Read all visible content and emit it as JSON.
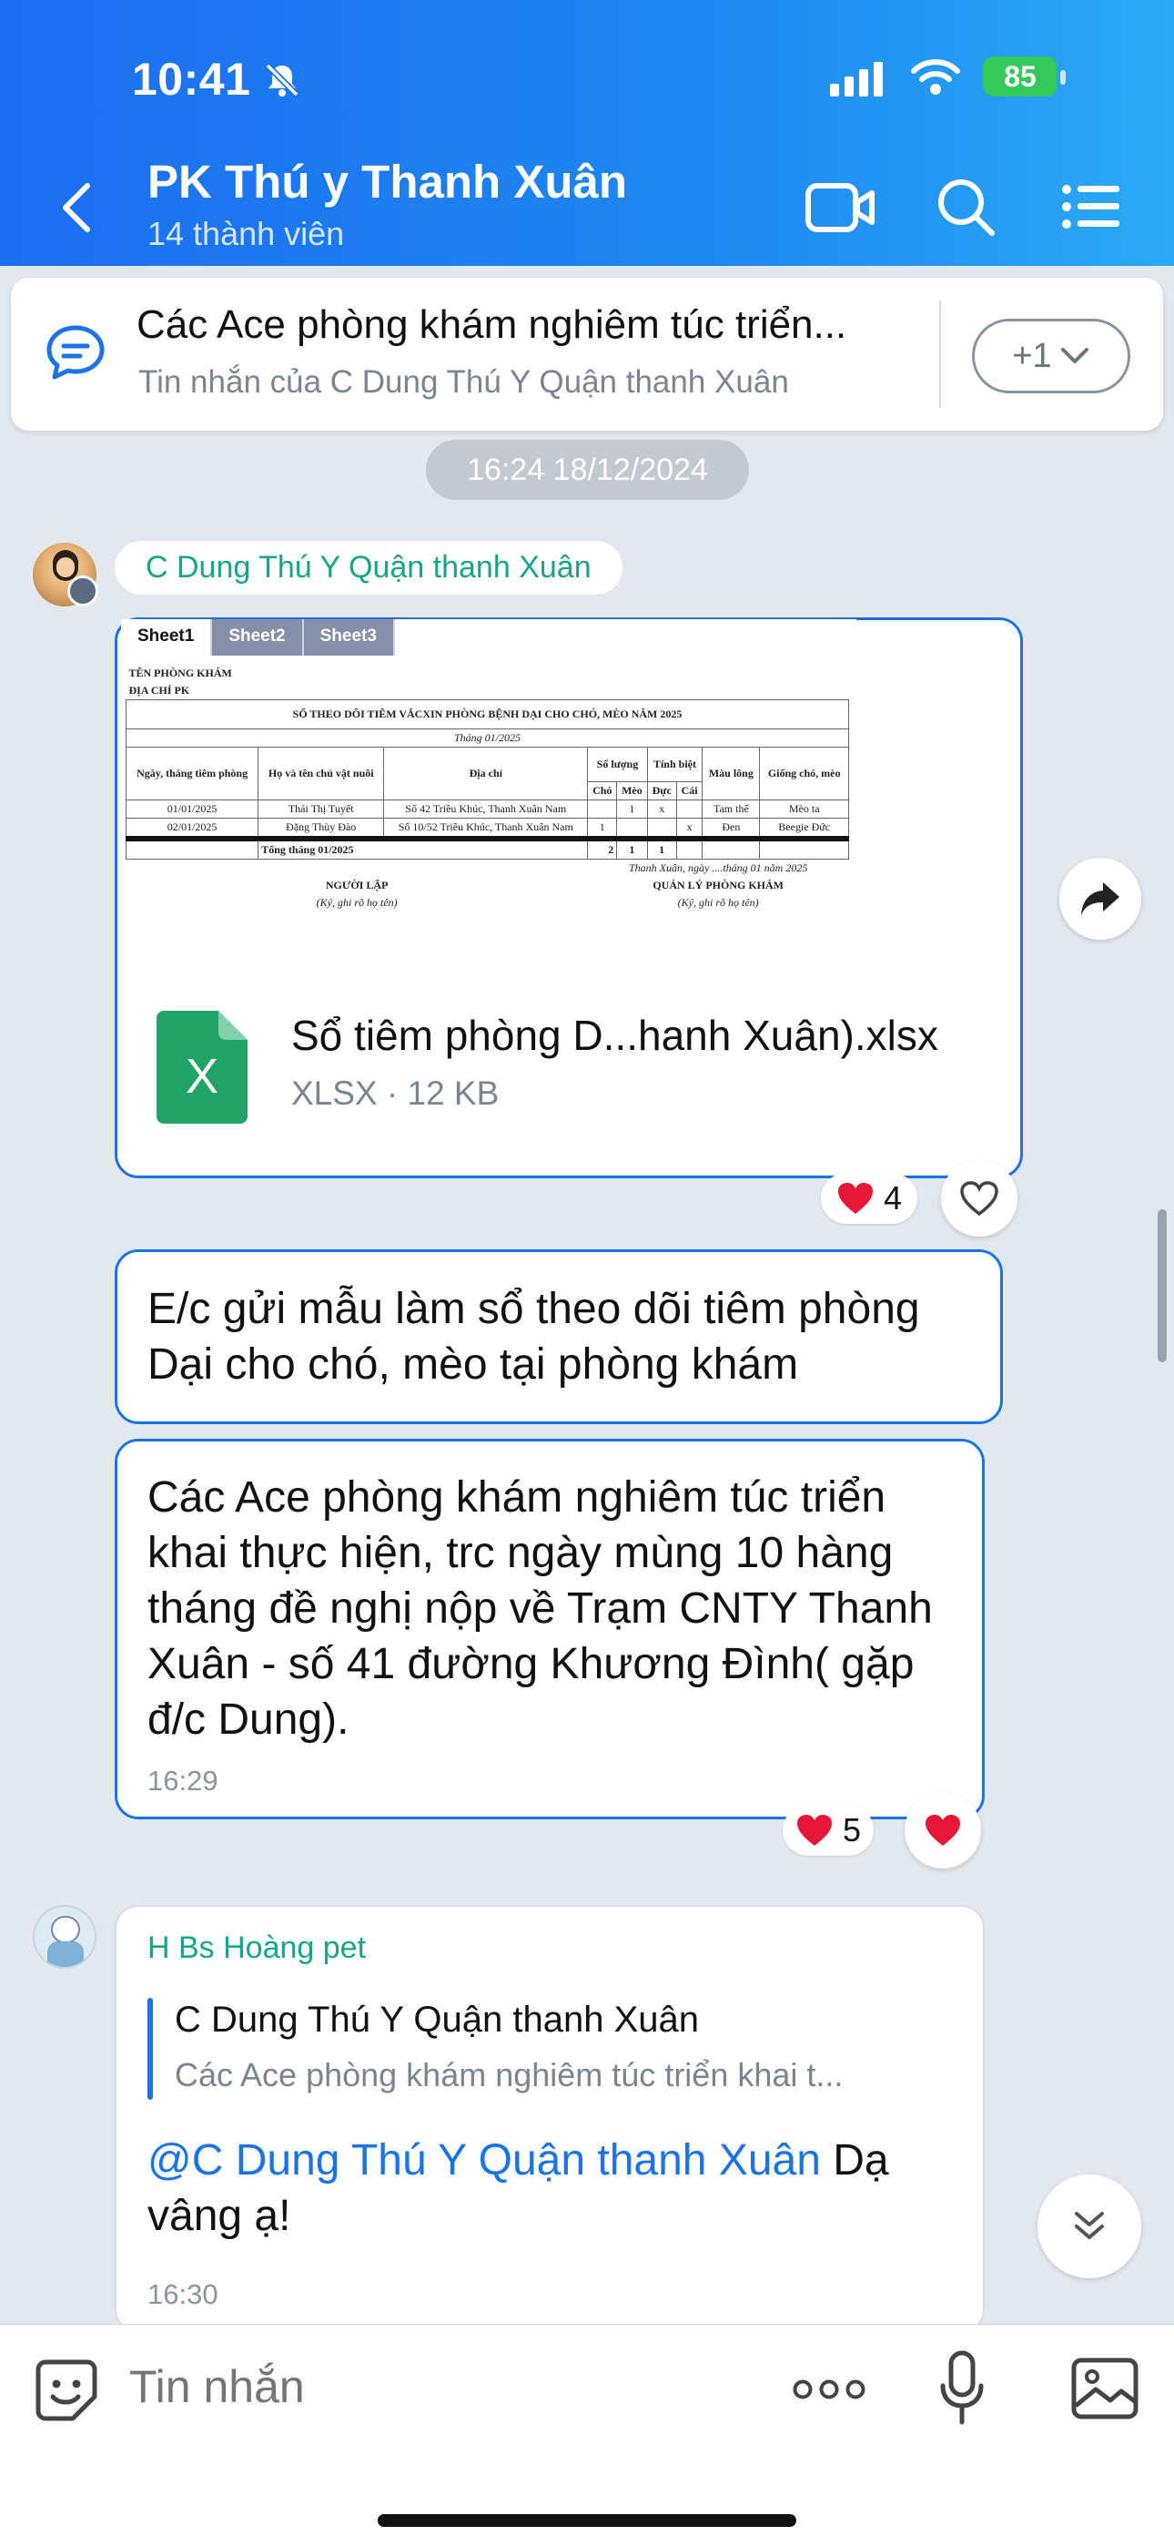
{
  "status_bar": {
    "time": "10:41",
    "battery": "85"
  },
  "header": {
    "title": "PK Thú y Thanh Xuân",
    "subtitle": "14 thành viên"
  },
  "pinned": {
    "text": "Các Ace phòng khám nghiêm túc triển...",
    "sub": "Tin nhắn của C Dung Thú Y Quận thanh Xuân",
    "more_label": "+1"
  },
  "date_separator": "16:24 18/12/2024",
  "message1": {
    "sender": "C Dung Thú Y Quận thanh Xuân",
    "sheet_tabs": [
      "Sheet1",
      "Sheet2",
      "Sheet3"
    ],
    "sheet": {
      "clinic_name": "TÊN PHÒNG KHÁM",
      "clinic_address": "ĐỊA CHỈ PK",
      "title": "SỔ THEO DÕI TIÊM VẮCXIN PHÒNG BỆNH DẠI CHO CHÓ, MÈO NĂM 2025",
      "month": "Tháng 01/2025",
      "headers": [
        "Ngày, tháng tiêm phòng",
        "Họ và tên chủ vật nuôi",
        "Địa chỉ",
        "Số lượng",
        "Tính biệt",
        "Màu lông",
        "Giống chó, mèo"
      ],
      "subheaders": [
        "Chó",
        "Mèo",
        "Đực",
        "Cái"
      ],
      "rows": [
        [
          "01/01/2025",
          "Thái Thị Tuyết",
          "Số 42 Triều Khúc, Thanh Xuân Nam",
          "",
          "1",
          "x",
          "",
          "Tam thể",
          "Mèo ta"
        ],
        [
          "02/01/2025",
          "Đặng Thùy Đào",
          "Số 10/52 Triều Khúc, Thanh Xuân Nam",
          "1",
          "",
          "",
          "x",
          "Đen",
          "Beegie Đức"
        ]
      ],
      "total_label": "Tổng tháng 01/2025",
      "totals": [
        "2",
        "1",
        "1"
      ],
      "date_line": "Thanh Xuân, ngày ....tháng 01 năm 2025",
      "preparer": "NGƯỜI LẬP",
      "preparer_note": "(Ký, ghi rõ họ tên)",
      "manager": "QUẢN LÝ PHÒNG KHÁM",
      "manager_note": "(Ký, ghi rõ họ tên)"
    },
    "file_name": "Sổ tiêm phòng D...hanh Xuân).xlsx",
    "file_meta": "XLSX · 12 KB",
    "file_icon_letter": "X",
    "reaction_count": "4"
  },
  "message2": {
    "text": "E/c gửi mẫu làm sổ theo dõi tiêm phòng Dại cho chó, mèo tại phòng khám"
  },
  "message3": {
    "text": "Các Ace phòng khám nghiêm túc triển khai thực hiện, trc ngày mùng 10 hàng tháng đề nghị nộp về Trạm CNTY Thanh Xuân - số 41 đường Khương Đình( gặp đ/c Dung).",
    "time": "16:29",
    "reaction_count": "5"
  },
  "message4": {
    "sender": "H Bs Hoàng pet",
    "quote_author": "C Dung Thú Y Quận thanh Xuân",
    "quote_text": "Các Ace phòng khám nghiêm túc triển khai t...",
    "mention": "@C Dung Thú Y Quận thanh Xuân",
    "text": " Dạ vâng ạ!",
    "time": "16:30"
  },
  "composer": {
    "placeholder": "Tin nhắn"
  },
  "colors": {
    "accent": "#1a73e8",
    "header_start": "#1b6ef0",
    "header_end": "#2aa9f5",
    "sender_name": "#17a589",
    "heart": "#e8173a",
    "excel_green": "#21a366"
  },
  "icons": [
    "back-icon",
    "video-call-icon",
    "search-icon",
    "menu-list-icon",
    "chat-bubble-icon",
    "chevron-down-icon",
    "share-arrow-icon",
    "heart-outline-icon",
    "heart-filled-icon",
    "excel-file-icon",
    "scroll-down-icon",
    "sticker-icon",
    "more-icon",
    "microphone-icon",
    "image-icon"
  ]
}
